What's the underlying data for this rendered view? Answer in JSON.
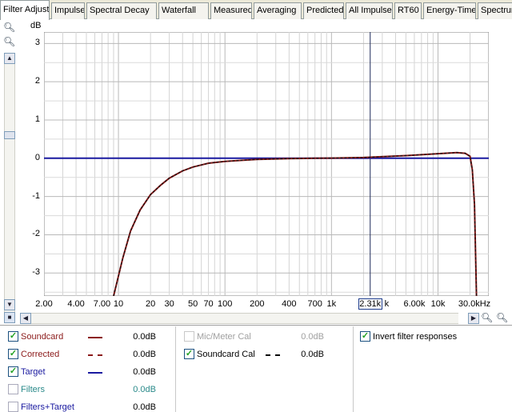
{
  "tabs": [
    {
      "label": "Filter Adjust",
      "active": true
    },
    {
      "label": "Impulse"
    },
    {
      "label": "Spectral Decay"
    },
    {
      "label": "Waterfall"
    },
    {
      "label": "Measured"
    },
    {
      "label": "Averaging"
    },
    {
      "label": "Predicted"
    },
    {
      "label": "All Impulses"
    },
    {
      "label": "RT60"
    },
    {
      "label": "Energy-Time"
    },
    {
      "label": "Spectrum"
    }
  ],
  "chart_data": {
    "type": "line",
    "ylabel": "dB",
    "y_ticks": [
      "3",
      "2",
      "1",
      "0",
      "-1",
      "-2",
      "-3"
    ],
    "ylim": [
      -3.6,
      3.3
    ],
    "x_scale": "log",
    "xlim": [
      2,
      30000
    ],
    "x_tick_labels": [
      "2.00",
      "4.00",
      "7.00",
      "10",
      "20",
      "30",
      "50",
      "70",
      "100",
      "200",
      "400",
      "700",
      "1k",
      "2.31k",
      "k",
      "6.00k",
      "10k",
      "30.0kHz"
    ],
    "cursor": {
      "label": "2.31k"
    },
    "grid": true,
    "series": [
      {
        "name": "Soundcard",
        "color": "#8b1a1a",
        "style": "solid",
        "x": [
          9,
          11,
          13,
          16,
          20,
          25,
          30,
          40,
          50,
          70,
          100,
          150,
          200,
          400,
          700,
          1000,
          2000,
          5000,
          10000,
          15000,
          18000,
          20000,
          21000,
          22000,
          23000
        ],
        "y": [
          -3.6,
          -2.6,
          -1.9,
          -1.35,
          -0.95,
          -0.7,
          -0.52,
          -0.33,
          -0.23,
          -0.13,
          -0.08,
          -0.05,
          -0.03,
          -0.01,
          0,
          0.005,
          0.02,
          0.07,
          0.12,
          0.15,
          0.13,
          0.05,
          -0.3,
          -1.2,
          -3.6
        ]
      },
      {
        "name": "Corrected",
        "color": "#8b1a1a",
        "style": "dashed",
        "x": [
          9,
          11,
          13,
          16,
          20,
          25,
          30,
          40,
          50,
          70,
          100,
          150,
          200,
          400,
          700,
          1000,
          2000,
          5000,
          10000,
          15000,
          18000,
          20000,
          21000,
          22000,
          23000
        ],
        "y": [
          -3.6,
          -2.6,
          -1.9,
          -1.35,
          -0.95,
          -0.7,
          -0.52,
          -0.33,
          -0.23,
          -0.13,
          -0.08,
          -0.05,
          -0.03,
          -0.01,
          0,
          0.005,
          0.02,
          0.07,
          0.12,
          0.15,
          0.13,
          0.05,
          -0.3,
          -1.2,
          -3.6
        ]
      },
      {
        "name": "Target",
        "color": "#1a1aa0",
        "style": "solid",
        "x": [
          2,
          30000
        ],
        "y": [
          0,
          0
        ]
      }
    ]
  },
  "legend": {
    "left": [
      {
        "label": "Soundcard",
        "value": "0.0dB",
        "checked": true,
        "label_color": "#8b1a1a",
        "swatch_color": "#8b1a1a",
        "swatch": "solid"
      },
      {
        "label": "Corrected",
        "value": "0.0dB",
        "checked": true,
        "label_color": "#8b1a1a",
        "swatch_color": "#8b1a1a",
        "swatch": "dashed"
      },
      {
        "label": "Target",
        "value": "0.0dB",
        "checked": true,
        "label_color": "#1a1aa0",
        "swatch_color": "#1a1aa0",
        "swatch": "solid"
      },
      {
        "label": "Filters",
        "value": "0.0dB",
        "checked": false,
        "label_color": "#2a8a8a",
        "value_color": "#2a8a8a",
        "swatch": "none"
      },
      {
        "label": "Filters+Target",
        "value": "0.0dB",
        "checked": false,
        "label_color": "#1a1aa0",
        "swatch": "none"
      }
    ],
    "middle": [
      {
        "label": "Mic/Meter Cal",
        "value": "0.0dB",
        "checked": false,
        "disabled": true,
        "label_color": "#a0a0a0",
        "value_color": "#a0a0a0",
        "swatch": "none"
      },
      {
        "label": "Soundcard Cal",
        "value": "0.0dB",
        "checked": true,
        "label_color": "#000000",
        "swatch_color": "#000000",
        "swatch": "dashed"
      }
    ],
    "right": {
      "invert_label": "Invert filter responses",
      "invert_checked": true
    }
  }
}
